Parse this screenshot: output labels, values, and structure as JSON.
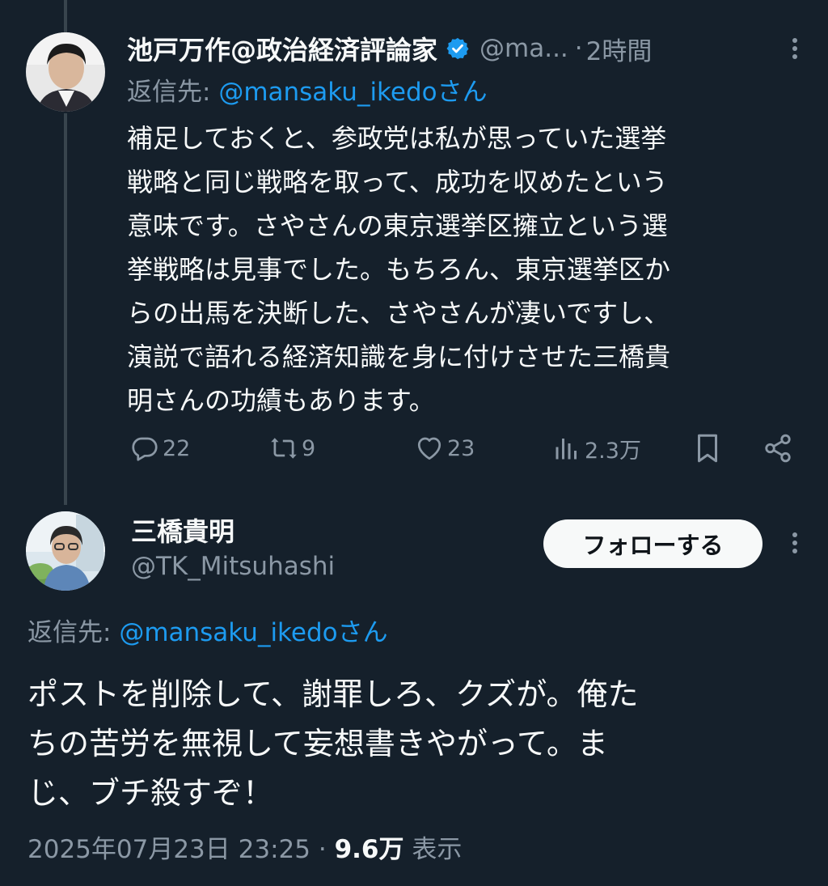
{
  "tweet1": {
    "author_name": "池戸万作@政治経済評論家",
    "handle": "@ma...",
    "separator": "·",
    "time": "2時間",
    "reply_prefix": "返信先:",
    "reply_mention": "@mansaku_ikedoさん",
    "body_lines": [
      "補足しておくと、参政党は私が思っていた選挙",
      "戦略と同じ戦略を取って、成功を収めたという",
      "意味です。さやさんの東京選挙区擁立という選",
      "挙戦略は見事でした。もちろん、東京選挙区か",
      "らの出馬を決断した、さやさんが凄いですし、",
      "演説で語れる経済知識を身に付けさせた三橋貴",
      "明さんの功績もあります。"
    ],
    "stats": {
      "replies": "22",
      "reposts": "9",
      "likes": "23",
      "views": "2.3万"
    }
  },
  "tweet2": {
    "author_name": "三橋貴明",
    "handle": "@TK_Mitsuhashi",
    "follow_label": "フォローする",
    "reply_prefix": "返信先:",
    "reply_mention": "@mansaku_ikedoさん",
    "body_lines": [
      "ポストを削除して、謝罪しろ、クズが。俺た",
      "ちの苦労を無視して妄想書きやがって。ま",
      "じ、ブチ殺すぞ！"
    ],
    "timestamp": "2025年07月23日 23:25",
    "separator": "·",
    "views_count": "9.6万",
    "views_label": "表示"
  },
  "colors": {
    "background": "#15202b",
    "text_primary": "#f7f9f9",
    "text_secondary": "#8b98a5",
    "accent": "#1d9bf0",
    "thread_line": "#38444d"
  }
}
